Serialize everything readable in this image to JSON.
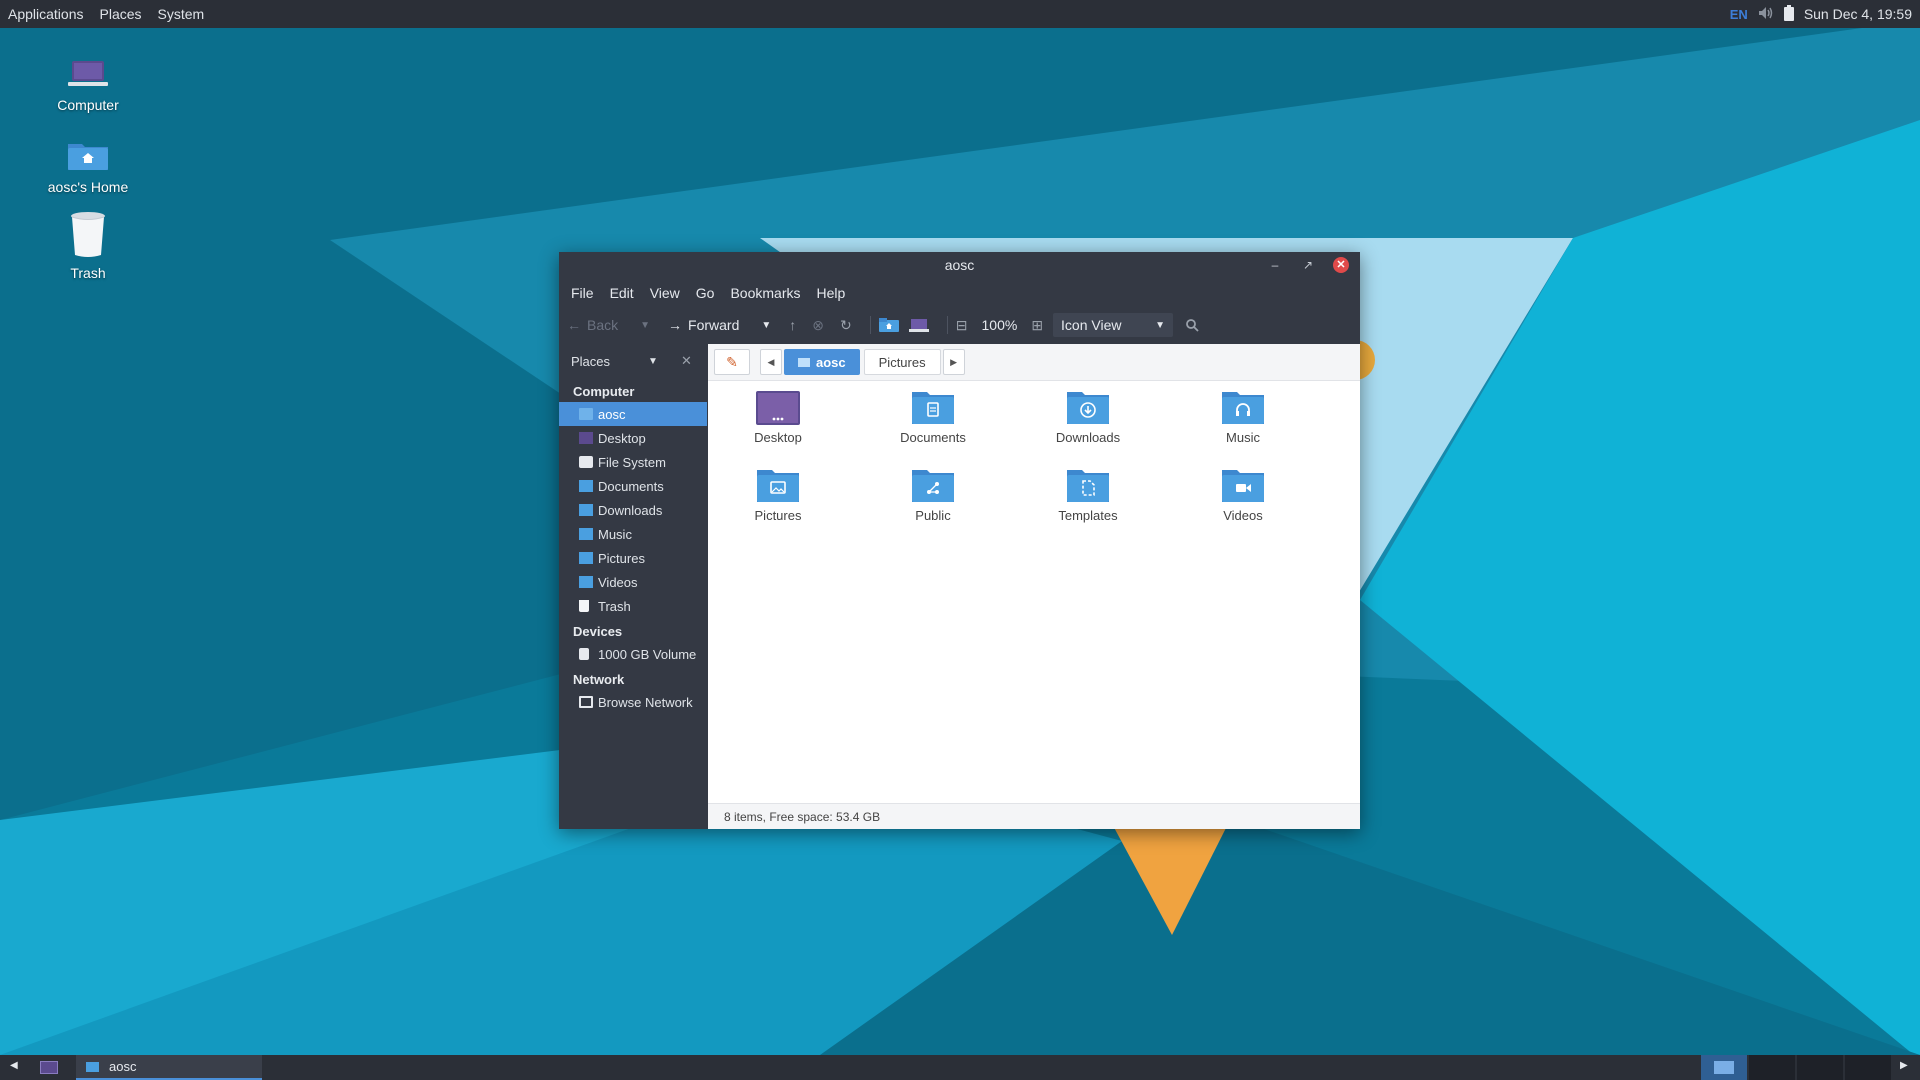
{
  "top_panel": {
    "menus": [
      "Applications",
      "Places",
      "System"
    ],
    "lang": "EN",
    "clock": "Sun Dec 4, 19:59"
  },
  "desktop_icons": [
    {
      "label": "Computer",
      "icon": "computer-icon"
    },
    {
      "label": "aosc's Home",
      "icon": "home-folder-icon"
    },
    {
      "label": "Trash",
      "icon": "trash-icon"
    }
  ],
  "window": {
    "title": "aosc",
    "menu": [
      "File",
      "Edit",
      "View",
      "Go",
      "Bookmarks",
      "Help"
    ],
    "toolbar": {
      "back": "Back",
      "forward": "Forward",
      "zoom": "100%",
      "view_mode": "Icon View"
    },
    "sidebar": {
      "title": "Places",
      "sections": {
        "computer": "Computer",
        "devices": "Devices",
        "network": "Network"
      },
      "computer_items": [
        "aosc",
        "Desktop",
        "File System",
        "Documents",
        "Downloads",
        "Music",
        "Pictures",
        "Videos",
        "Trash"
      ],
      "device_items": [
        "1000 GB Volume"
      ],
      "network_items": [
        "Browse Network"
      ],
      "active": "aosc"
    },
    "path": {
      "crumbs": [
        "aosc",
        "Pictures"
      ],
      "active": "aosc"
    },
    "files": [
      {
        "name": "Desktop",
        "icon": "desktop-folder-icon"
      },
      {
        "name": "Documents",
        "icon": "documents-folder-icon"
      },
      {
        "name": "Downloads",
        "icon": "downloads-folder-icon"
      },
      {
        "name": "Music",
        "icon": "music-folder-icon"
      },
      {
        "name": "Pictures",
        "icon": "pictures-folder-icon"
      },
      {
        "name": "Public",
        "icon": "public-folder-icon"
      },
      {
        "name": "Templates",
        "icon": "templates-folder-icon"
      },
      {
        "name": "Videos",
        "icon": "videos-folder-icon"
      }
    ],
    "status": "8 items, Free space: 53.4 GB"
  },
  "taskbar": {
    "task_label": "aosc"
  },
  "colors": {
    "accent": "#4a90d9",
    "panel": "#2b2f37",
    "window_dark": "#343944",
    "folder": "#4a9fe0",
    "close": "#e04a4a"
  }
}
